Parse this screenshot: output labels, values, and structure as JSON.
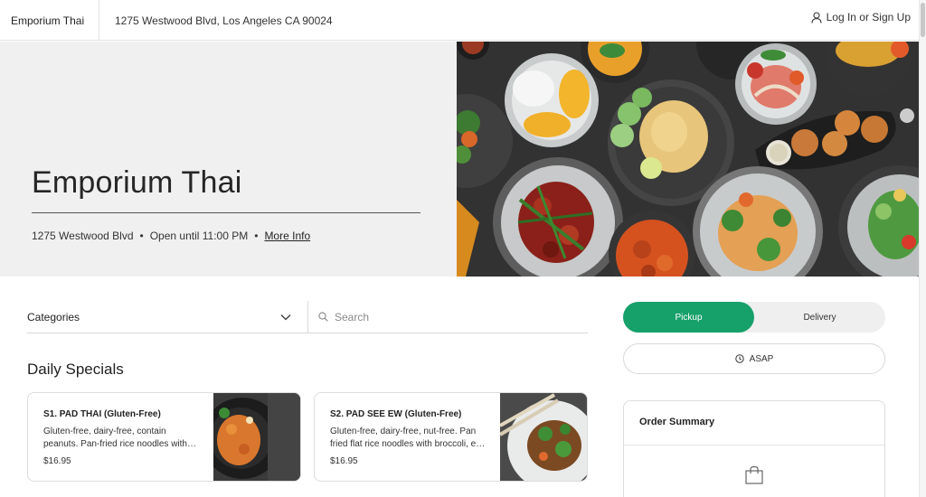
{
  "header": {
    "brand": "Emporium Thai",
    "address": "1275 Westwood Blvd, Los Angeles CA 90024",
    "login_label": "Log In or Sign Up",
    "login_icon": "user-icon"
  },
  "hero": {
    "title": "Emporium Thai",
    "meta_address": "1275 Westwood Blvd",
    "meta_hours": "Open until 11:00 PM",
    "more_info": "More Info"
  },
  "menu": {
    "categories_label": "Categories",
    "search_placeholder": "Search",
    "section_title": "Daily Specials",
    "items": [
      {
        "name": "S1. PAD THAI (Gluten-Free)",
        "description": "Gluten-free, dairy-free, contain peanuts. Pan-fried rice noodles with shrimp, tofu, egg and bean sprouts.",
        "price": "$16.95"
      },
      {
        "name": "S2. PAD SEE EW (Gluten-Free)",
        "description": "Gluten-free, dairy-free, nut-free. Pan fried flat rice noodles with broccoli, egg and carrots.",
        "price": "$16.95"
      }
    ]
  },
  "order": {
    "pickup_label": "Pickup",
    "delivery_label": "Delivery",
    "time_label": "ASAP",
    "summary_title": "Order Summary",
    "accent": "#16a06a"
  }
}
